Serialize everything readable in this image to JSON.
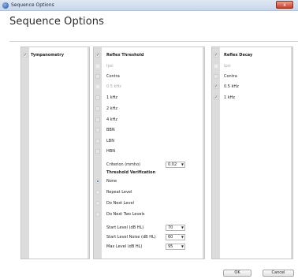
{
  "window": {
    "title": "Sequence Options",
    "close_glyph": "x"
  },
  "page": {
    "heading": "Sequence Options"
  },
  "tympanometry": {
    "label": "Tympanometry",
    "checked": true
  },
  "reflex_threshold": {
    "label": "Reflex Threshold",
    "checked": true,
    "options": [
      {
        "label": "Ipsi",
        "checked": false,
        "disabled": true
      },
      {
        "label": "Contra",
        "checked": false,
        "disabled": false
      },
      {
        "label": "0.5 kHz",
        "checked": false,
        "disabled": true
      },
      {
        "label": "1 kHz",
        "checked": false,
        "disabled": false
      },
      {
        "label": "2 kHz",
        "checked": false,
        "disabled": false
      },
      {
        "label": "4 kHz",
        "checked": false,
        "disabled": false
      },
      {
        "label": "BBN",
        "checked": false,
        "disabled": false
      },
      {
        "label": "LBN",
        "checked": false,
        "disabled": false
      },
      {
        "label": "HBN",
        "checked": false,
        "disabled": false
      }
    ],
    "criterion": {
      "label": "Criterion (mmho)",
      "value": "0.02"
    },
    "verification": {
      "title": "Threshold Verification",
      "options": [
        {
          "label": "None",
          "selected": true
        },
        {
          "label": "Repeat Level",
          "selected": false
        },
        {
          "label": "Do Next Level",
          "selected": false
        },
        {
          "label": "Do Next Two Levels",
          "selected": false
        }
      ]
    },
    "levels": [
      {
        "label": "Start Level (dB HL)",
        "value": "70"
      },
      {
        "label": "Start Level Noise (dB HL)",
        "value": "60"
      },
      {
        "label": "Max Level (dB HL)",
        "value": "95"
      }
    ]
  },
  "reflex_decay": {
    "label": "Reflex Decay",
    "checked": true,
    "options": [
      {
        "label": "Ipsi",
        "checked": false,
        "disabled": true
      },
      {
        "label": "Contra",
        "checked": false,
        "disabled": false
      },
      {
        "label": "0.5 kHz",
        "checked": true,
        "disabled": false
      },
      {
        "label": "1 kHz",
        "checked": true,
        "disabled": false
      }
    ]
  },
  "footer": {
    "ok_label": "OK",
    "cancel_label": "Cancel"
  }
}
